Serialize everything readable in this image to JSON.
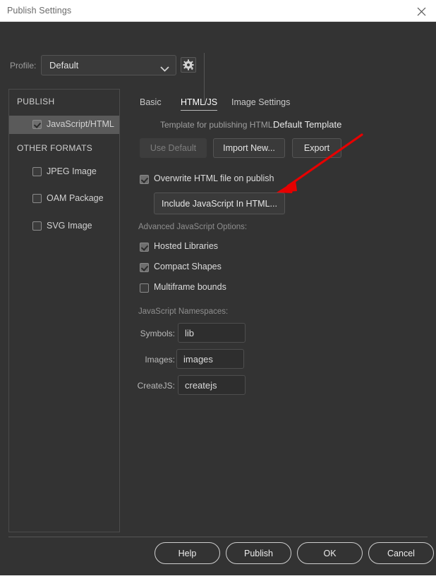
{
  "window": {
    "title": "Publish Settings",
    "close_icon": "close-icon"
  },
  "profile": {
    "label": "Profile:",
    "value": "Default",
    "options": [
      "Default"
    ],
    "chevron_icon": "chevron-down-icon",
    "gear_icon": "gear-icon"
  },
  "sidebar": {
    "groups": [
      {
        "heading": "PUBLISH",
        "items": [
          {
            "label": "JavaScript/HTML",
            "checked": true,
            "selected": true
          }
        ]
      },
      {
        "heading": "OTHER FORMATS",
        "items": [
          {
            "label": "JPEG Image",
            "checked": false,
            "selected": false
          },
          {
            "label": "OAM Package",
            "checked": false,
            "selected": false
          },
          {
            "label": "SVG Image",
            "checked": false,
            "selected": false
          }
        ]
      }
    ]
  },
  "main": {
    "tabs": [
      {
        "label": "Basic",
        "active": false
      },
      {
        "label": "HTML/JS",
        "active": true
      },
      {
        "label": "Image Settings",
        "active": false
      }
    ],
    "template": {
      "label": "Template for publishing HTML:",
      "value": "Default Template"
    },
    "template_buttons": [
      {
        "label": "Use Default",
        "disabled": true
      },
      {
        "label": "Import New...",
        "disabled": false
      },
      {
        "label": "Export",
        "disabled": false
      }
    ],
    "overwrite": {
      "label": "Overwrite HTML file on publish",
      "checked": true
    },
    "include_js_button": {
      "label": "Include JavaScript In HTML..."
    },
    "advanced_label": "Advanced JavaScript Options:",
    "advanced_options": [
      {
        "label": "Hosted Libraries",
        "checked": true
      },
      {
        "label": "Compact Shapes",
        "checked": true
      },
      {
        "label": "Multiframe bounds",
        "checked": false
      }
    ],
    "namespaces_label": "JavaScript Namespaces:",
    "namespace_fields": [
      {
        "label": "Symbols:",
        "value": "lib"
      },
      {
        "label": "Images:",
        "value": "images"
      },
      {
        "label": "CreateJS:",
        "value": "createjs"
      }
    ]
  },
  "footer": {
    "buttons": [
      {
        "label": "Help"
      },
      {
        "label": "Publish"
      },
      {
        "label": "OK"
      },
      {
        "label": "Cancel"
      }
    ]
  },
  "annotation": {
    "arrow_color": "#e60000",
    "description": "red-arrow-pointing-to-include-javascript-button"
  },
  "colors": {
    "window_bg": "#333333",
    "titlebar_bg": "#ffffff",
    "panel_border": "#4b4b4b",
    "selected_row": "#5a5a5a",
    "control_bg": "#3a3a3a",
    "text_primary": "#e6e6e6",
    "text_muted": "#9c9c9c"
  }
}
